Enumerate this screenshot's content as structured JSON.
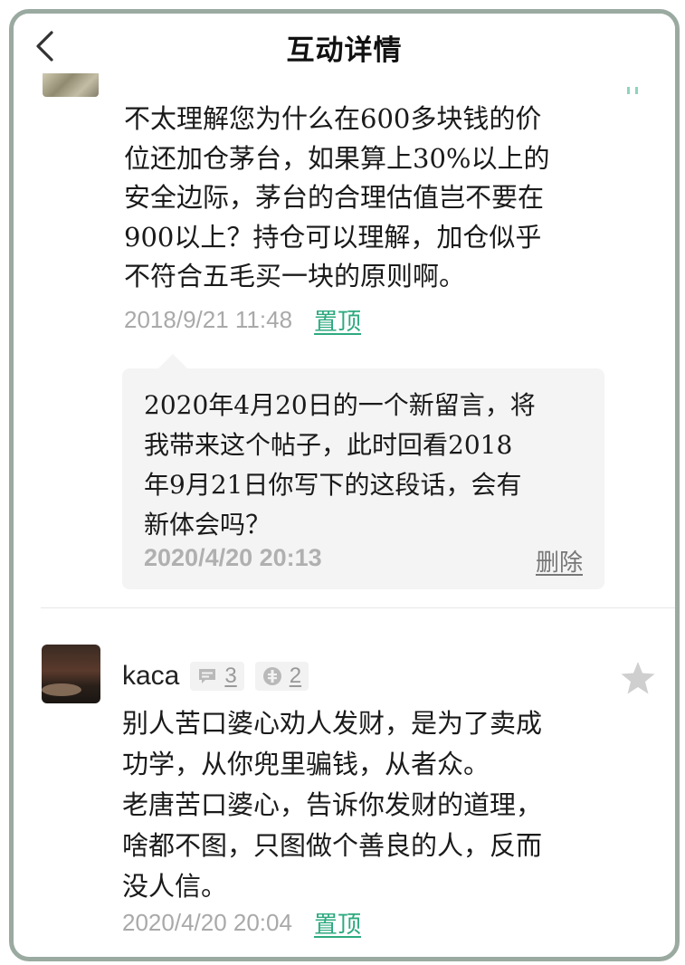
{
  "header": {
    "title": "互动详情"
  },
  "comment1": {
    "text": "不太理解您为什么在600多块钱的价\n位还加仓茅台，如果算上30%以上的\n安全边际，茅台的合理估值岂不要在\n900以上？持仓可以理解，加仓似乎\n不符合五毛买一块的原则啊。",
    "time": "2018/9/21 11:48",
    "pin_label": "置顶",
    "reply": {
      "text": "2020年4月20日的一个新留言，将\n我带来这个帖子，此时回看2018\n年9月21日你写下的这段话，会有\n新体会吗？",
      "time": "2020/4/20 20:13",
      "delete_label": "删除"
    }
  },
  "comment2": {
    "username": "kaca",
    "comment_count": "3",
    "like_count": "2",
    "text": "别人苦口婆心劝人发财，是为了卖成\n功学，从你兜里骗钱，从者众。\n老唐苦口婆心，告诉你发财的道理，\n啥都不图，只图做个善良的人，反而\n没人信。",
    "time": "2020/4/20 20:04",
    "pin_label": "置顶"
  },
  "colors": {
    "accent_green": "#2eaa7f",
    "frame_border": "#9aaaa1",
    "reply_bg": "#f4f4f4"
  },
  "icons": {
    "back": "chevron-left-icon",
    "comment": "comment-bubble-icon",
    "like": "coin-icon",
    "star": "star-icon"
  }
}
